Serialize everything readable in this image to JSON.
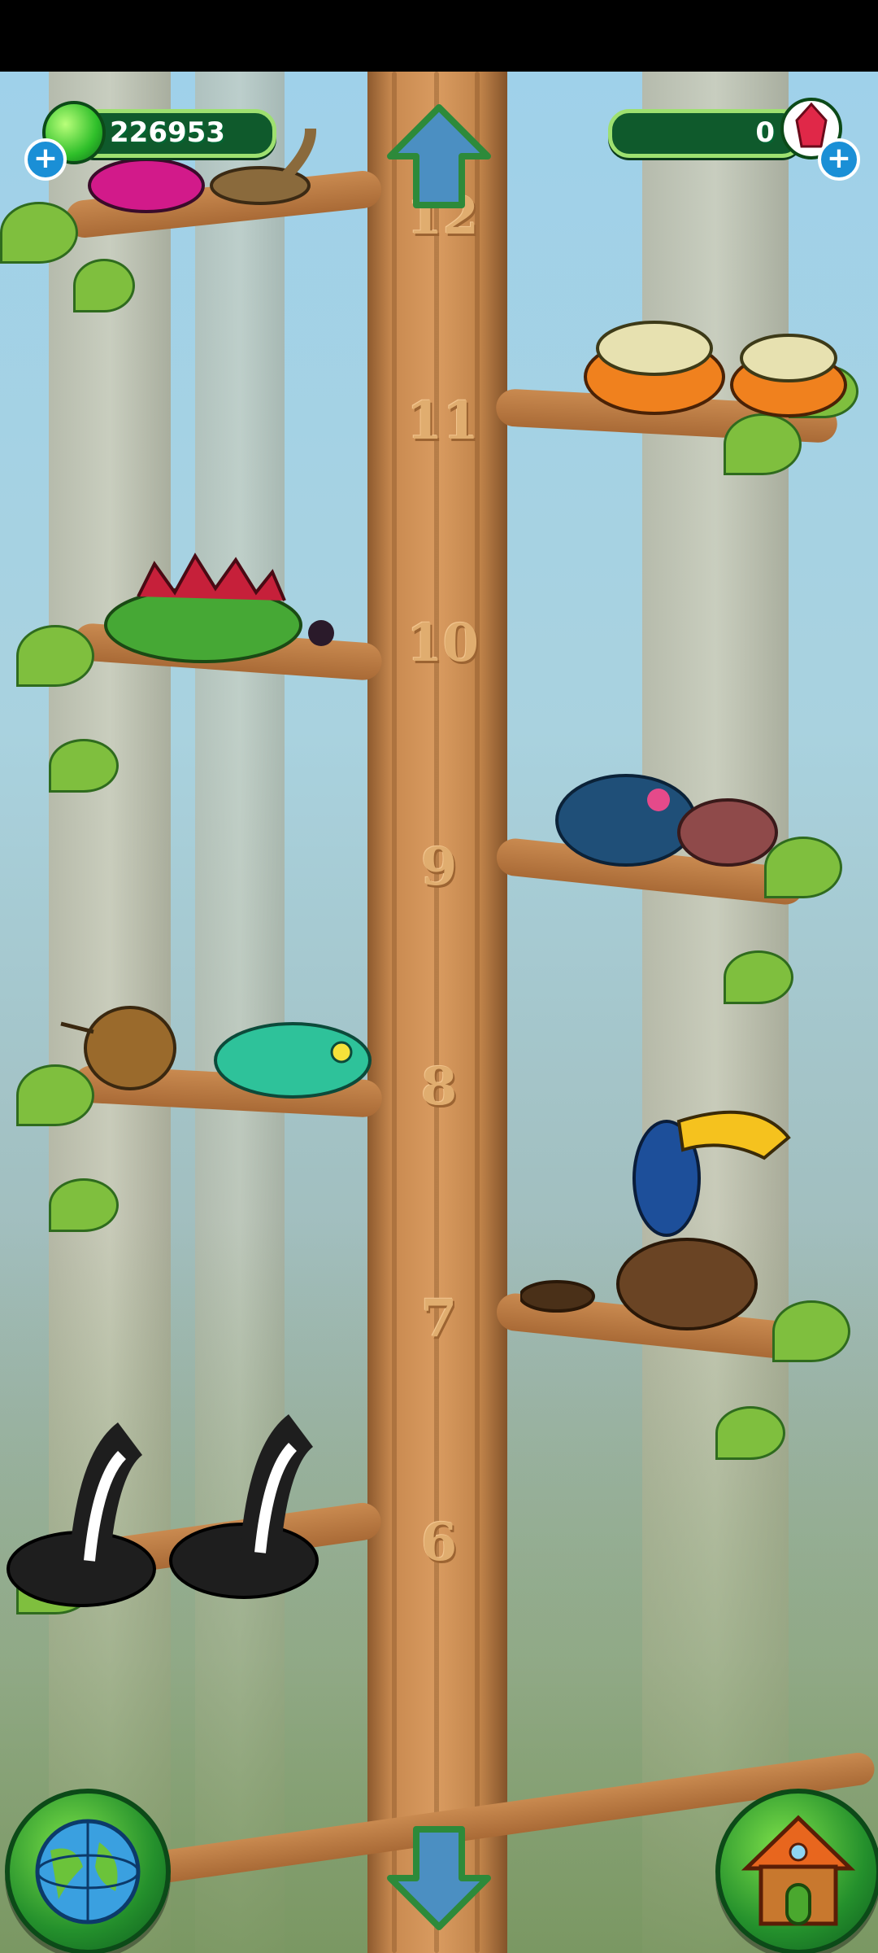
{
  "hud": {
    "coins": {
      "value": "226953",
      "icon": "green-gem-icon"
    },
    "gems": {
      "value": "0",
      "icon": "red-crystal-icon"
    }
  },
  "levels": [
    "12",
    "11",
    "10",
    "9",
    "8",
    "7",
    "6"
  ],
  "nav": {
    "up": "arrow-up-icon",
    "down": "arrow-down-icon",
    "globe": "globe-icon",
    "home": "house-icon"
  },
  "colors": {
    "accent": "#9ee070",
    "hud_bg": "#0f5a2c",
    "trunk": "#c98a50"
  }
}
